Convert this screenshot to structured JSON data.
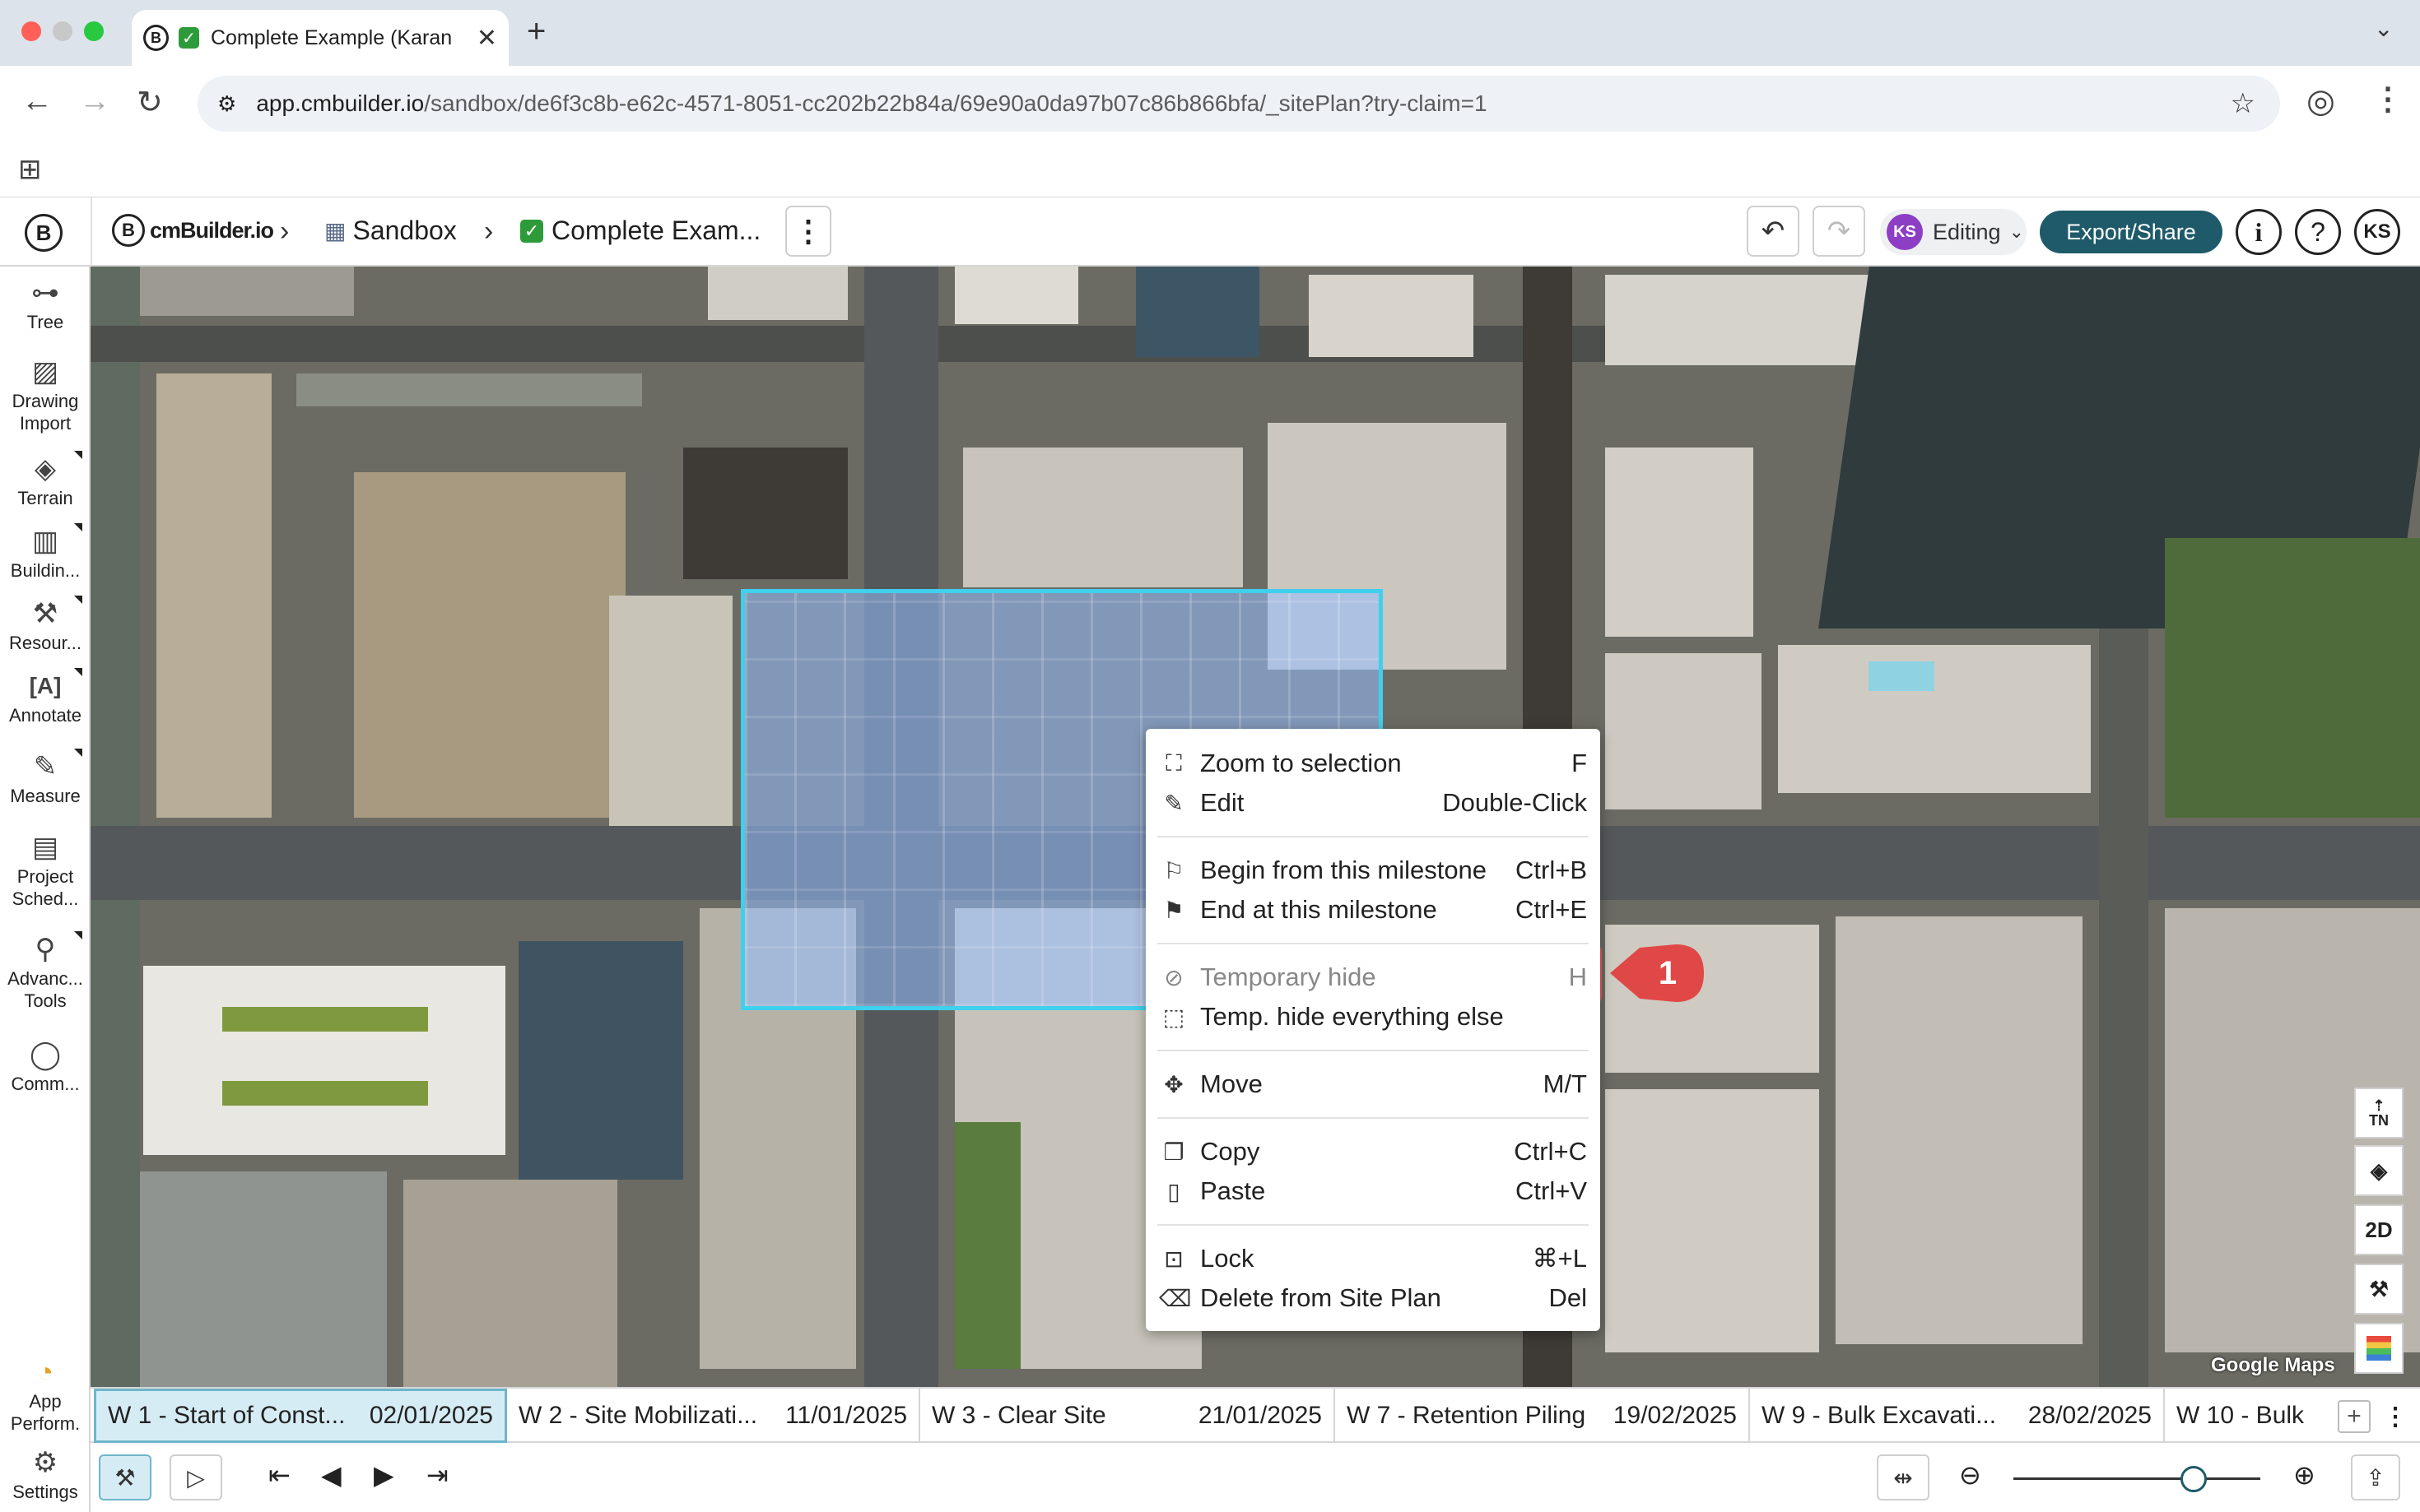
{
  "browser": {
    "tab_title": "Complete Example (Karan",
    "tab_close": "✕",
    "new_tab": "+",
    "url_host": "app.cmbuilder.io",
    "url_path": "/sandbox/de6f3c8b-e62c-4571-8051-cc202b22b84a/69e90a0da97b07c86b866bfa/_sitePlan?try-claim=1"
  },
  "header": {
    "brand": "cmBuilder.io",
    "breadcrumb_sandbox": "Sandbox",
    "breadcrumb_project": "Complete Exam...",
    "editing_initials": "KS",
    "editing_label": "Editing",
    "export_label": "Export/Share",
    "user_initials": "KS"
  },
  "left_tools": [
    {
      "label1": "Tree",
      "label2": ""
    },
    {
      "label1": "Drawing",
      "label2": "Import"
    },
    {
      "label1": "Terrain",
      "label2": ""
    },
    {
      "label1": "Buildin...",
      "label2": ""
    },
    {
      "label1": "Resour...",
      "label2": ""
    },
    {
      "label1": "Annotate",
      "label2": ""
    },
    {
      "label1": "Measure",
      "label2": ""
    },
    {
      "label1": "Project",
      "label2": "Sched..."
    },
    {
      "label1": "Advanc...",
      "label2": "Tools"
    },
    {
      "label1": "Comm...",
      "label2": ""
    },
    {
      "label1": "App",
      "label2": "Perform."
    },
    {
      "label1": "Settings",
      "label2": ""
    }
  ],
  "context_menu": {
    "items": [
      {
        "label": "Zoom to selection",
        "shortcut": "F"
      },
      {
        "label": "Edit",
        "shortcut": "Double-Click"
      },
      {
        "label": "Begin from this milestone",
        "shortcut": "Ctrl+B"
      },
      {
        "label": "End at this milestone",
        "shortcut": "Ctrl+E"
      },
      {
        "label": "Temporary hide",
        "shortcut": "H"
      },
      {
        "label": "Temp. hide everything else",
        "shortcut": ""
      },
      {
        "label": "Move",
        "shortcut": "M/T"
      },
      {
        "label": "Copy",
        "shortcut": "Ctrl+C"
      },
      {
        "label": "Paste",
        "shortcut": "Ctrl+V"
      },
      {
        "label": "Lock",
        "shortcut": "⌘+L"
      },
      {
        "label": "Delete from Site Plan",
        "shortcut": "Del"
      }
    ]
  },
  "callout_number": "1",
  "map": {
    "attribution": "Google Maps",
    "controls": [
      "TN",
      "2D"
    ]
  },
  "timeline": {
    "milestones": [
      {
        "name": "W 1 - Start of Const...",
        "date": "02/01/2025"
      },
      {
        "name": "W 2 - Site Mobilizati...",
        "date": "11/01/2025"
      },
      {
        "name": "W 3 - Clear Site",
        "date": "21/01/2025"
      },
      {
        "name": "W 7 - Retention Piling",
        "date": "19/02/2025"
      },
      {
        "name": "W 9 - Bulk Excavati...",
        "date": "28/02/2025"
      },
      {
        "name": "W 10 - Bulk",
        "date": ""
      }
    ]
  },
  "zoom": {
    "level_percent": 73
  }
}
